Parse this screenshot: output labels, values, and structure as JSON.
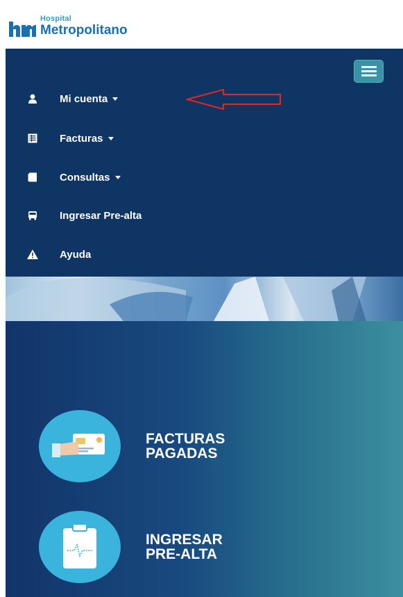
{
  "brand": {
    "small": "Hospital",
    "big": "Metropolitano",
    "primary_color": "#1a6fb3",
    "secondary_color": "#2e9fc4"
  },
  "navbar": {
    "background": "#0e3563",
    "toggle_icon": "hamburger-menu-icon",
    "items": [
      {
        "label": "Mi cuenta",
        "icon": "user-icon",
        "dropdown": true
      },
      {
        "label": "Facturas",
        "icon": "invoice-icon",
        "dropdown": true
      },
      {
        "label": "Consultas",
        "icon": "documents-icon",
        "dropdown": true
      },
      {
        "label": "Ingresar Pre-alta",
        "icon": "bus-icon",
        "dropdown": false
      },
      {
        "label": "Ayuda",
        "icon": "warning-icon",
        "dropdown": false
      }
    ]
  },
  "annotation": {
    "arrow_color": "#e0261f",
    "points_to": "Mi cuenta"
  },
  "features": [
    {
      "line1": "FACTURAS",
      "line2": "PAGADAS",
      "icon": "payment-card-icon"
    },
    {
      "line1": "INGRESAR",
      "line2": "PRE-ALTA",
      "icon": "clipboard-heartbeat-icon"
    }
  ]
}
